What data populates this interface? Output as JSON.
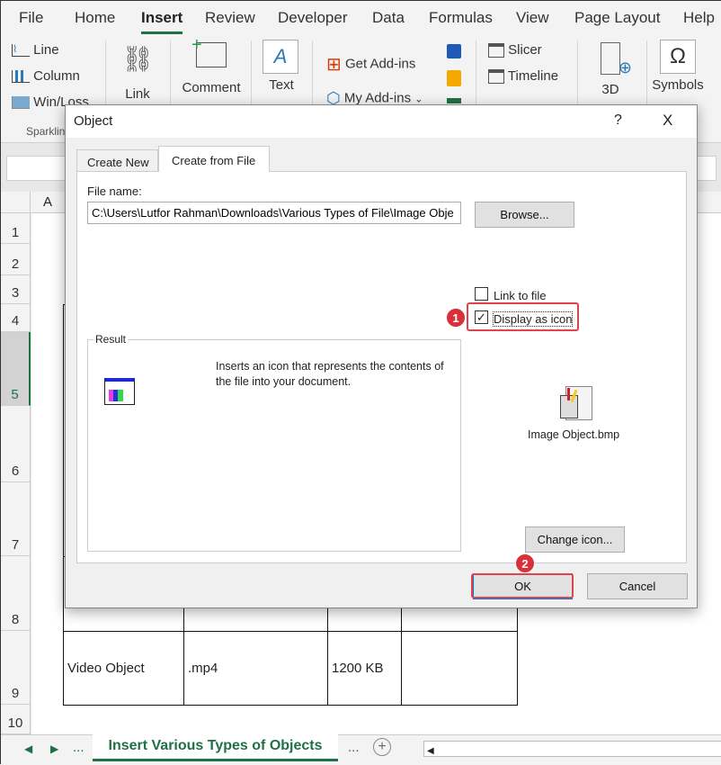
{
  "menu": {
    "tabs": [
      "File",
      "Home",
      "Insert",
      "Review",
      "Developer",
      "Data",
      "Formulas",
      "View",
      "Page Layout",
      "Help"
    ],
    "active": "Insert"
  },
  "ribbon": {
    "sparklines": [
      "Line",
      "Column",
      "Win/Loss"
    ],
    "sparklines_group": "Sparklines",
    "link": "Link",
    "comment": "Comment",
    "text": "Text",
    "get_addins": "Get Add-ins",
    "my_addins": "My Add-ins",
    "slicer": "Slicer",
    "timeline": "Timeline",
    "maps3d": "3D",
    "symbols": "Symbols"
  },
  "sheet": {
    "col_a": "A",
    "rows": [
      "1",
      "2",
      "3",
      "4",
      "5",
      "6",
      "7",
      "8",
      "9",
      "10"
    ],
    "video_row": {
      "name": "Video Object",
      "ext": ".mp4",
      "size": "1200 KB"
    }
  },
  "sheet_tabs": {
    "active": "Insert Various Types of Objects",
    "more": "..."
  },
  "dialog": {
    "title": "Object",
    "help": "?",
    "close": "X",
    "tabs": [
      "Create New",
      "Create from File"
    ],
    "active_tab": "Create from File",
    "file_name_label": "File name:",
    "file_name_value": "C:\\Users\\Lutfor Rahman\\Downloads\\Various Types of File\\Image Obje",
    "browse": "Browse...",
    "link_to_file": "Link to file",
    "link_checked": false,
    "display_as_icon": "Display as icon",
    "display_checked": true,
    "result_label": "Result",
    "result_text": "Inserts an icon that represents the contents of the file into your document.",
    "icon_caption": "Image Object.bmp",
    "change_icon": "Change icon...",
    "ok": "OK",
    "cancel": "Cancel"
  },
  "annotations": {
    "step1": "1",
    "step2": "2"
  },
  "colors": {
    "accent": "#1e7145",
    "highlight": "#e0444b"
  }
}
